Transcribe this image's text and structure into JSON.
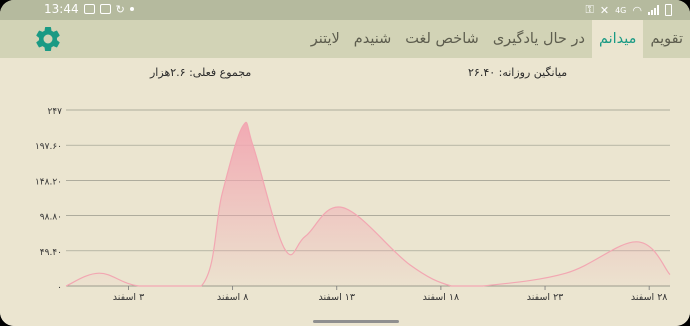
{
  "status_bar": {
    "time": "13:44",
    "left_icons": [
      "image-icon",
      "message-icon",
      "sync-icon",
      "dot-icon"
    ],
    "right_icons": [
      "key-icon",
      "mute-icon",
      "signal-4g-icon",
      "wifi-icon",
      "signal-icon",
      "battery-icon"
    ]
  },
  "toolbar": {
    "settings_icon": "gear-icon",
    "accent": "#1a9a84",
    "tabs": [
      {
        "label": "تقویم",
        "active": false
      },
      {
        "label": "میدانم",
        "active": true
      },
      {
        "label": "در حال یادگیری",
        "active": false
      },
      {
        "label": "شاخص لغت",
        "active": false
      },
      {
        "label": "شنیدم",
        "active": false
      },
      {
        "label": "لایتنر",
        "active": false
      }
    ]
  },
  "stats": {
    "daily_average": "میانگین روزانه: ۲۶.۴۰",
    "total_so_far": "مجموع فعلی: ۲.۶هزار"
  },
  "chart_data": {
    "type": "area",
    "color": "#f2a7b2",
    "ylim": [
      0,
      247
    ],
    "y_ticks": [
      0,
      49.4,
      98.8,
      148.2,
      197.6,
      247
    ],
    "y_tick_labels": [
      "۰",
      "۴۹.۴۰",
      "۹۸.۸۰",
      "۱۴۸.۲۰",
      "۱۹۷.۶۰",
      "۲۴۷"
    ],
    "xlim": [
      0,
      29
    ],
    "x_ticks": [
      3,
      8,
      13,
      18,
      23,
      28
    ],
    "x_tick_labels": [
      "۳ اسفند",
      "۸ اسفند",
      "۱۳ اسفند",
      "۱۸ اسفند",
      "۲۳ اسفند",
      "۲۸ اسفند"
    ],
    "x": [
      0,
      1.6,
      3.5,
      6.5,
      7.5,
      8.5,
      9.0,
      10.5,
      11.5,
      13.3,
      16.5,
      18.5,
      20,
      24,
      27.4,
      29
    ],
    "values": [
      0,
      18,
      0,
      0,
      130,
      225,
      195,
      52,
      70,
      110,
      30,
      0,
      0,
      18,
      62,
      16
    ]
  }
}
